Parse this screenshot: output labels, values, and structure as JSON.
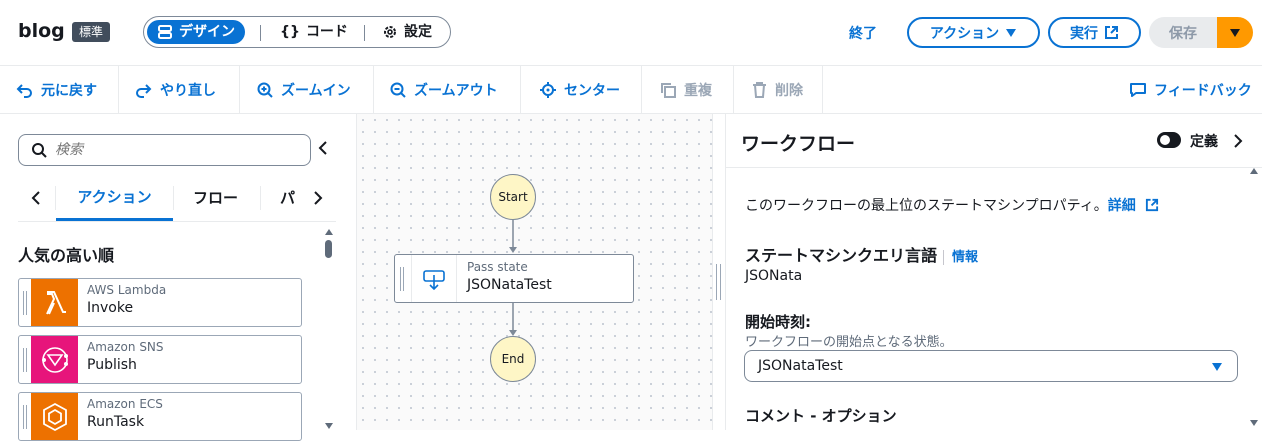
{
  "header": {
    "title": "blog",
    "badge": "標準",
    "modes": {
      "design": "デザイン",
      "code": "コード",
      "settings": "設定"
    },
    "exit": "終了",
    "action": "アクション",
    "run": "実行",
    "save": "保存"
  },
  "toolbar": {
    "undo": "元に戻す",
    "redo": "やり直し",
    "zoom_in": "ズームイン",
    "zoom_out": "ズームアウト",
    "center": "センター",
    "duplicate": "重複",
    "delete": "削除",
    "feedback": "フィードバック"
  },
  "left_panel": {
    "search_placeholder": "検索",
    "tabs": [
      "アクション",
      "フロー",
      "パ"
    ],
    "section_title": "人気の高い順",
    "items": [
      {
        "service": "AWS Lambda",
        "action": "Invoke",
        "color": "#ed7100"
      },
      {
        "service": "Amazon SNS",
        "action": "Publish",
        "color": "#e7157b"
      },
      {
        "service": "Amazon ECS",
        "action": "RunTask",
        "color": "#ed7100"
      }
    ]
  },
  "canvas": {
    "start_label": "Start",
    "end_label": "End",
    "state": {
      "type": "Pass state",
      "name": "JSONataTest"
    }
  },
  "right_panel": {
    "title": "ワークフロー",
    "toggle_label": "定義",
    "description": "このワークフローの最上位のステートマシンプロパティ。",
    "details_link": "詳細",
    "query_language_heading": "ステートマシンクエリ言語",
    "info_link": "情報",
    "query_language_value": "JSONata",
    "start_at_heading": "開始時刻:",
    "start_at_desc": "ワークフローの開始点となる状態。",
    "start_at_value": "JSONataTest",
    "comment_heading": "コメント - オプション"
  },
  "colors": {
    "accent": "#0972d3",
    "save_dropdown": "#ff9900",
    "state_circle": "#fef6c6"
  }
}
